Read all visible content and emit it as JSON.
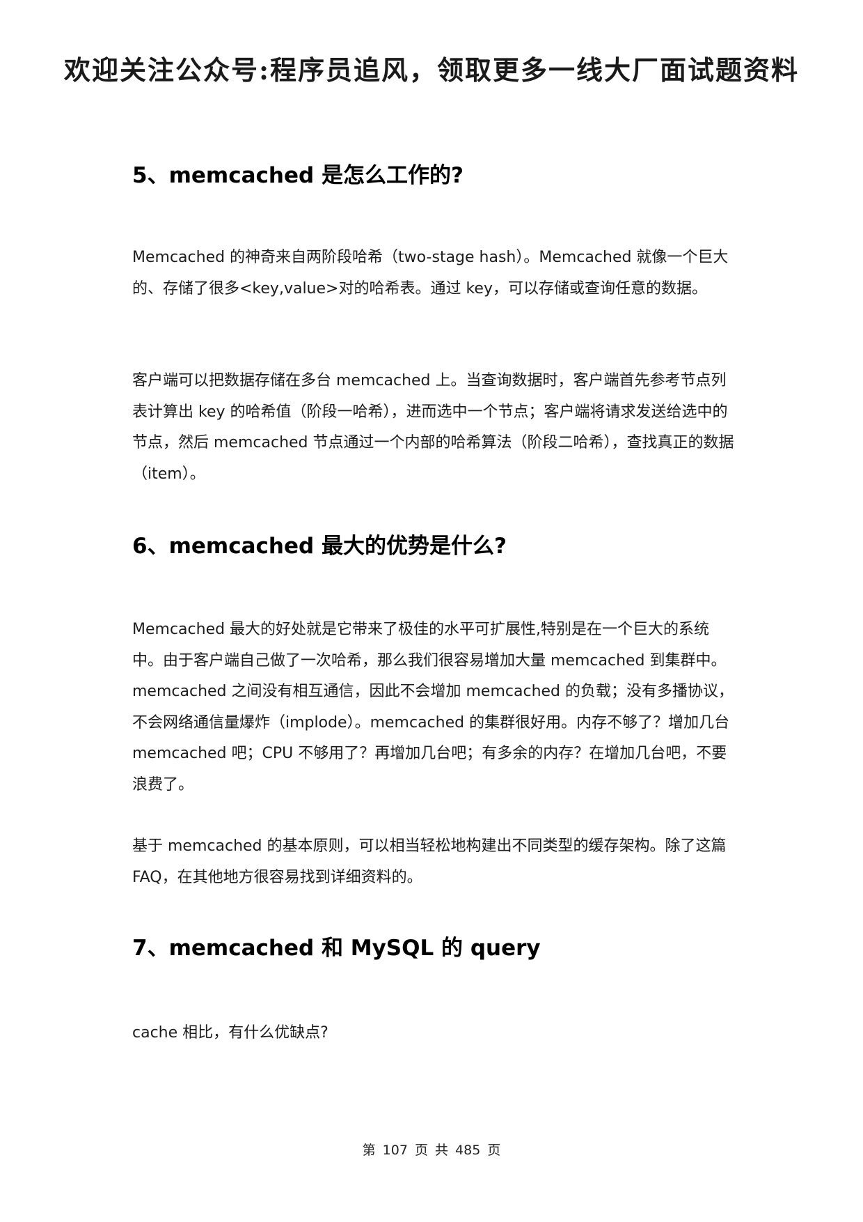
{
  "banner": {
    "text": "欢迎关注公众号:程序员追风，领取更多一线大厂面试题资料"
  },
  "sections": [
    {
      "heading": "5、memcached 是怎么工作的?",
      "paragraphs": [
        "Memcached 的神奇来自两阶段哈希（two-stage hash）。Memcached 就像一个巨大的、存储了很多<key,value>对的哈希表。通过 key，可以存储或查询任意的数据。",
        "客户端可以把数据存储在多台 memcached 上。当查询数据时，客户端首先参考节点列表计算出 key 的哈希值（阶段一哈希），进而选中一个节点；客户端将请求发送给选中的节点，然后 memcached 节点通过一个内部的哈希算法（阶段二哈希），查找真正的数据（item）。"
      ]
    },
    {
      "heading": "6、memcached 最大的优势是什么?",
      "paragraphs": [
        "Memcached 最大的好处就是它带来了极佳的水平可扩展性,特别是在一个巨大的系统中。由于客户端自己做了一次哈希，那么我们很容易增加大量 memcached 到集群中。memcached 之间没有相互通信，因此不会增加  memcached 的负载；没有多播协议，不会网络通信量爆炸（implode）。memcached 的集群很好用。内存不够了？增加几台 memcached 吧；CPU 不够用了？再增加几台吧；有多余的内存？在增加几台吧，不要浪费了。",
        "基于 memcached 的基本原则，可以相当轻松地构建出不同类型的缓存架构。除了这篇 FAQ，在其他地方很容易找到详细资料的。"
      ]
    },
    {
      "heading": "7、memcached 和 MySQL 的 query",
      "paragraphs": [
        "cache 相比，有什么优缺点?"
      ]
    }
  ],
  "footer": {
    "page_label": "第 107 页 共 485 页"
  }
}
